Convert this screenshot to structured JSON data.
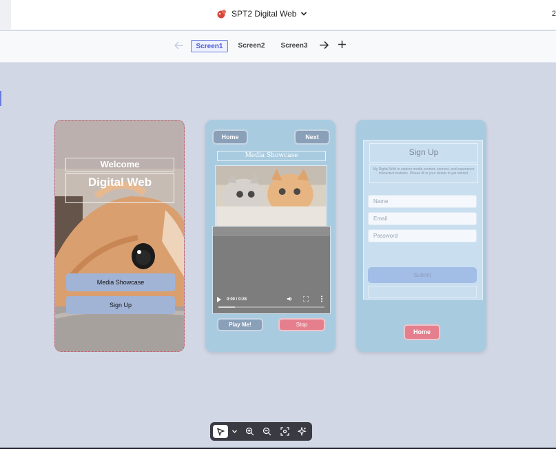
{
  "header": {
    "app_title": "SPT2 Digital Web",
    "corner_text": "2"
  },
  "tabs": [
    {
      "label": "Screen1",
      "active": true
    },
    {
      "label": "Screen2",
      "active": false
    },
    {
      "label": "Screen3",
      "active": false
    }
  ],
  "screen1": {
    "welcome": "Welcome",
    "title": "Digital Web",
    "btn_media": "Media Showcase",
    "btn_signup": "Sign Up"
  },
  "screen2": {
    "btn_home": "Home",
    "btn_next": "Next",
    "title": "Media Showcase",
    "video_time": "0:00 / 0:28",
    "btn_play": "Play Me!",
    "btn_stop": "Stop"
  },
  "screen3": {
    "title": "Sign Up",
    "description": "My Digital Web to explore media content, connect, and experience interactive features. Please fill in your details to get started.",
    "name_placeholder": "Name",
    "email_placeholder": "Email",
    "password_placeholder": "Password",
    "submit": "Submit",
    "btn_home": "Home"
  },
  "icons": {
    "logo": "app-logo-icon",
    "back": "arrow-left-icon",
    "forward": "arrow-right-icon",
    "add": "plus-icon",
    "select": "cursor-icon",
    "zoom_in": "zoom-in-icon",
    "zoom_out": "zoom-out-icon",
    "fit": "fit-screen-icon",
    "ai": "sparkle-icon"
  },
  "colors": {
    "accent": "#6b7bde",
    "canvas": "#d2d7e6",
    "screen_bg": "#a9cbe0",
    "button_blue": "#a2b4d6",
    "button_pink": "#e57f8d"
  }
}
